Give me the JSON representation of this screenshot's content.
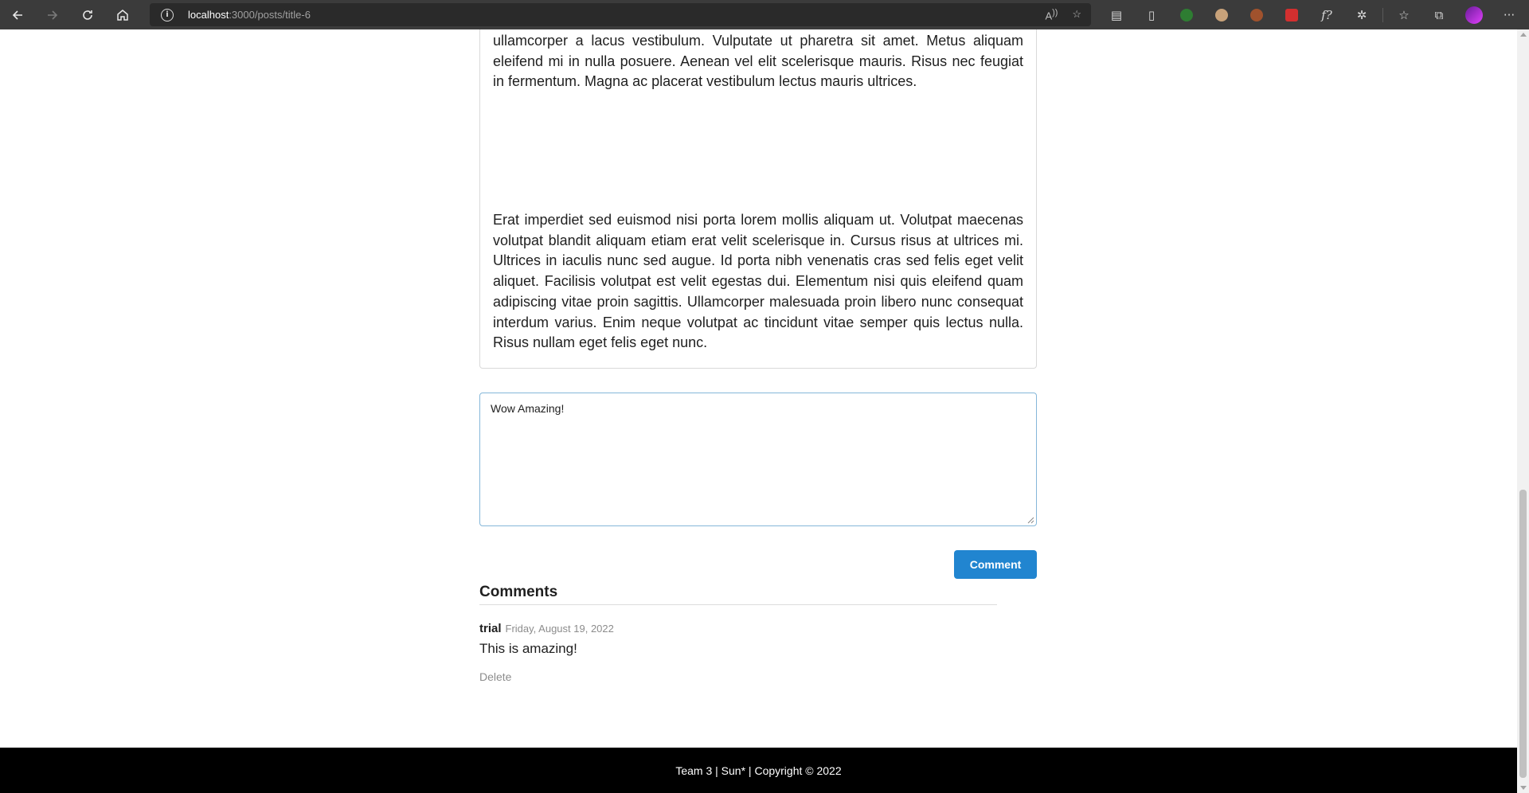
{
  "browser": {
    "url_host": "localhost",
    "url_path": ":3000/posts/title-6"
  },
  "post": {
    "paragraph_1": "ullamcorper a lacus vestibulum. Vulputate ut pharetra sit amet. Metus aliquam eleifend mi in nulla posuere. Aenean vel elit scelerisque mauris. Risus nec feugiat in fermentum. Magna ac placerat vestibulum lectus mauris ultrices.",
    "paragraph_2": "Erat imperdiet sed euismod nisi porta lorem mollis aliquam ut. Volutpat maecenas volutpat blandit aliquam etiam erat velit scelerisque in. Cursus risus at ultrices mi. Ultrices in iaculis nunc sed augue. Id porta nibh venenatis cras sed felis eget velit aliquet. Facilisis volutpat est velit egestas dui. Elementum nisi quis eleifend quam adipiscing vitae proin sagittis. Ullamcorper malesuada proin libero nunc consequat interdum varius. Enim neque volutpat ac tincidunt vitae semper quis lectus nulla. Risus nullam eget felis eget nunc."
  },
  "comment_form": {
    "value": "Wow Amazing!",
    "submit_label": "Comment"
  },
  "comments": {
    "header": "Comments",
    "items": [
      {
        "author": "trial",
        "date": "Friday, August 19, 2022",
        "text": "This is amazing!",
        "delete_label": "Delete"
      }
    ]
  },
  "footer": {
    "text": "Team 3 | Sun* | Copyright © 2022"
  },
  "colors": {
    "primary_button": "#2185d0",
    "footer_bg": "#000000",
    "browser_chrome": "#3b3b3b"
  }
}
